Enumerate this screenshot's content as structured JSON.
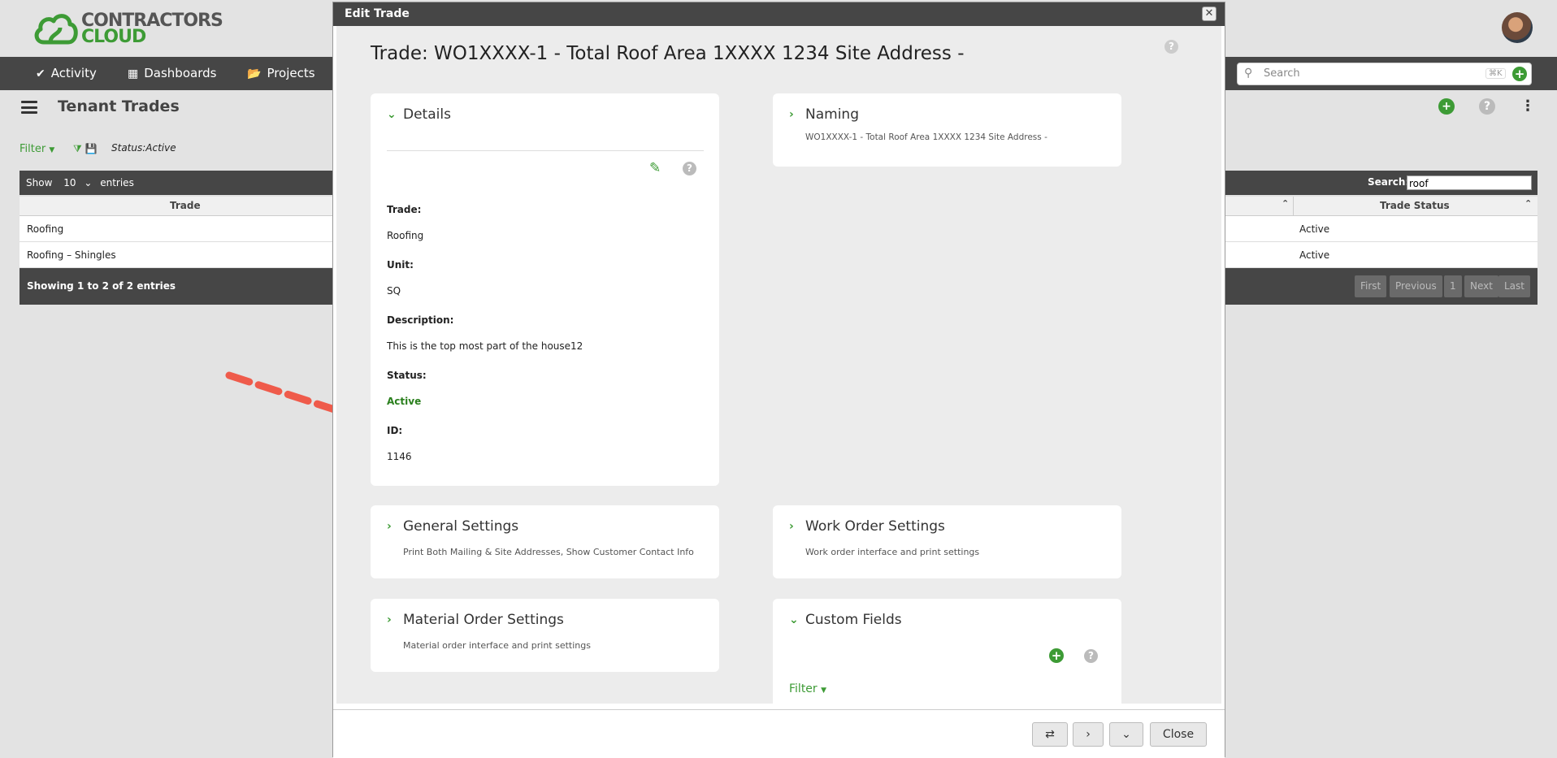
{
  "brand": {
    "line1": "CONTRACTORS",
    "line2": "CLOUD",
    "color": "#3d9b35"
  },
  "nav": {
    "items": [
      {
        "label": "Activity",
        "icon": "check-circle-icon"
      },
      {
        "label": "Dashboards",
        "icon": "grid-icon"
      },
      {
        "label": "Projects",
        "icon": "folder-open-icon"
      }
    ]
  },
  "search": {
    "placeholder": "Search",
    "shortcut": "⌘K"
  },
  "page": {
    "title": "Tenant Trades",
    "filter_label": "Filter",
    "status_filter": "Status:Active"
  },
  "table": {
    "show": "Show",
    "show_count": "10",
    "entries": "entries",
    "search_label": "Search:",
    "search_value": "roof",
    "columns": [
      "Trade",
      "Trade Status"
    ],
    "rows": [
      {
        "trade": "Roofing",
        "status": "Active"
      },
      {
        "trade": "Roofing – Shingles",
        "status": "Active"
      }
    ],
    "info": "Showing 1 to 2 of 2 entries",
    "pagination": [
      "First",
      "Previous",
      "1",
      "Next",
      "Last"
    ]
  },
  "modal": {
    "title": "Edit Trade",
    "heading": "Trade: WO1XXXX-1 - Total Roof Area 1XXXX 1234 Site Address -",
    "details": {
      "title": "Details",
      "fields": [
        {
          "label": "Trade:",
          "value": "Roofing"
        },
        {
          "label": "Unit:",
          "value": "SQ"
        },
        {
          "label": "Description:",
          "value": "This is the top most part of the house12"
        },
        {
          "label": "Status:",
          "value": "Active"
        },
        {
          "label": "ID:",
          "value": "1146"
        }
      ]
    },
    "naming": {
      "title": "Naming",
      "subtitle": "WO1XXXX-1 - Total Roof Area 1XXXX 1234 Site Address -"
    },
    "general": {
      "title": "General Settings",
      "subtitle": "Print Both Mailing & Site Addresses, Show Customer Contact Info"
    },
    "work_order": {
      "title": "Work Order Settings",
      "subtitle": "Work order interface and print settings"
    },
    "material": {
      "title": "Material Order Settings",
      "subtitle": "Material order interface and print settings"
    },
    "custom_fields": {
      "title": "Custom Fields",
      "filter_label": "Filter"
    },
    "footer": {
      "close_label": "Close"
    }
  },
  "colors": {
    "accent": "#3d9b35",
    "bar": "#464646",
    "status_active": "#2a7f1d",
    "annotation": "#ef5b4b"
  }
}
